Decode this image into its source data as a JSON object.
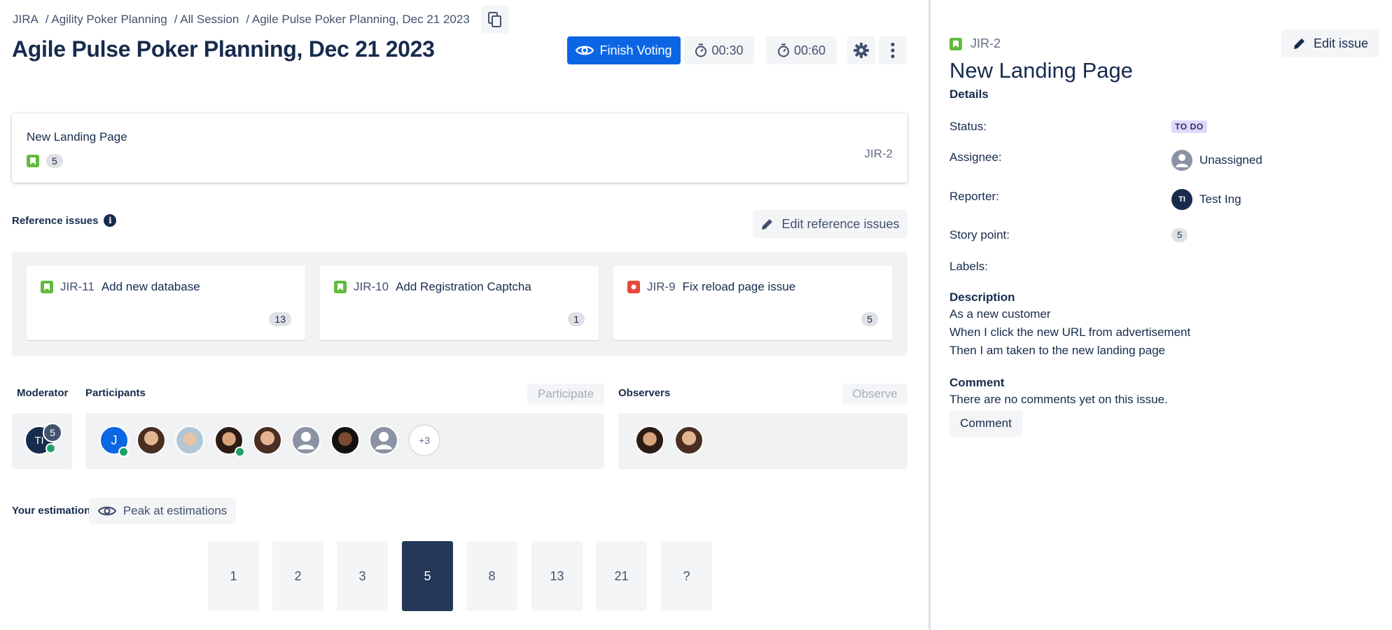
{
  "breadcrumb": [
    "JIRA",
    "/ Agility Poker Planning",
    "/ All Session",
    "/ Agile Pulse Poker Planning, Dec 21 2023"
  ],
  "page_title": "Agile Pulse Poker Planning, Dec 21 2023",
  "toolbar": {
    "finish_label": "Finish Voting",
    "timer_1": "00:30",
    "timer_2": "00:60"
  },
  "current_issue": {
    "title": "New Landing Page",
    "points": "5",
    "key": "JIR-2"
  },
  "reference": {
    "label": "Reference issues",
    "edit_label": "Edit reference issues",
    "items": [
      {
        "key": "JIR-11",
        "title": "Add new database",
        "points": "13",
        "type": "story"
      },
      {
        "key": "JIR-10",
        "title": "Add Registration Captcha",
        "points": "1",
        "type": "story"
      },
      {
        "key": "JIR-9",
        "title": "Fix reload page issue",
        "points": "5",
        "type": "bug"
      }
    ]
  },
  "people": {
    "moderator_label": "Moderator",
    "moderator_initials": "TI",
    "moderator_badge": "5",
    "participants_label": "Participants",
    "participate_label": "Participate",
    "participant_initial": "J",
    "more_count": "+3",
    "observers_label": "Observers",
    "observe_label": "Observe"
  },
  "estimation": {
    "label": "Your estimation",
    "peek_label": "Peak at estimations",
    "cards": [
      "1",
      "2",
      "3",
      "5",
      "8",
      "13",
      "21",
      "?"
    ],
    "selected": "5"
  },
  "detail": {
    "key": "JIR-2",
    "edit_label": "Edit issue",
    "title": "New Landing Page",
    "details_heading": "Details",
    "status_label": "Status:",
    "status_value": "TO DO",
    "assignee_label": "Assignee:",
    "assignee_value": "Unassigned",
    "reporter_label": "Reporter:",
    "reporter_initials": "TI",
    "reporter_value": "Test Ing",
    "story_point_label": "Story point:",
    "story_point_value": "5",
    "labels_label": "Labels:",
    "description_heading": "Description",
    "description_lines": [
      "As a new customer",
      "When I click the new URL from advertisement",
      "Then I am taken to the new landing page"
    ],
    "comment_heading": "Comment",
    "comment_empty": "There are no comments yet on this issue.",
    "comment_button": "Comment"
  },
  "colors": {
    "primary": "#0c66e4",
    "story": "#63ba3c",
    "bug": "#e5493a",
    "selected_card": "#253858",
    "online": "#22a06b"
  }
}
